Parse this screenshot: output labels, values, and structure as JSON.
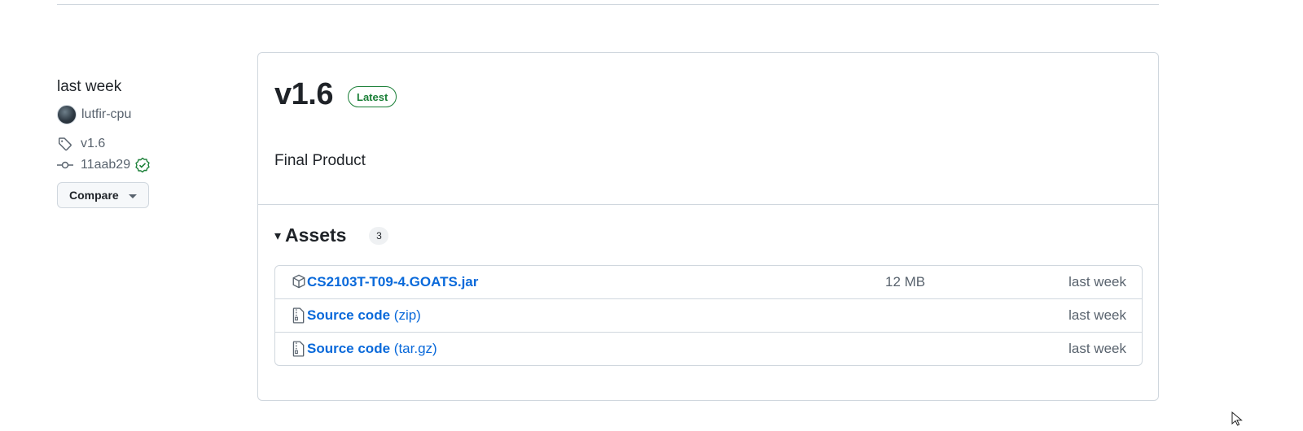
{
  "sidebar": {
    "date": "last week",
    "author": "lutfir-cpu",
    "tag": "v1.6",
    "commit": "11aab29",
    "compare_label": "Compare"
  },
  "release": {
    "title": "v1.6",
    "badge": "Latest",
    "notes": "Final Product"
  },
  "assets": {
    "heading": "Assets",
    "count": "3",
    "items": [
      {
        "icon": "package-icon",
        "name": "CS2103T-T09-4.GOATS.jar",
        "suffix": "",
        "size": "12 MB",
        "date": "last week"
      },
      {
        "icon": "file-zip-icon",
        "name": "Source code",
        "suffix": "(zip)",
        "size": "",
        "date": "last week"
      },
      {
        "icon": "file-zip-icon",
        "name": "Source code",
        "suffix": "(tar.gz)",
        "size": "",
        "date": "last week"
      }
    ]
  },
  "colors": {
    "link": "#0969da",
    "success": "#1a7f37",
    "border": "#d0d7de",
    "muted": "#59636e"
  }
}
